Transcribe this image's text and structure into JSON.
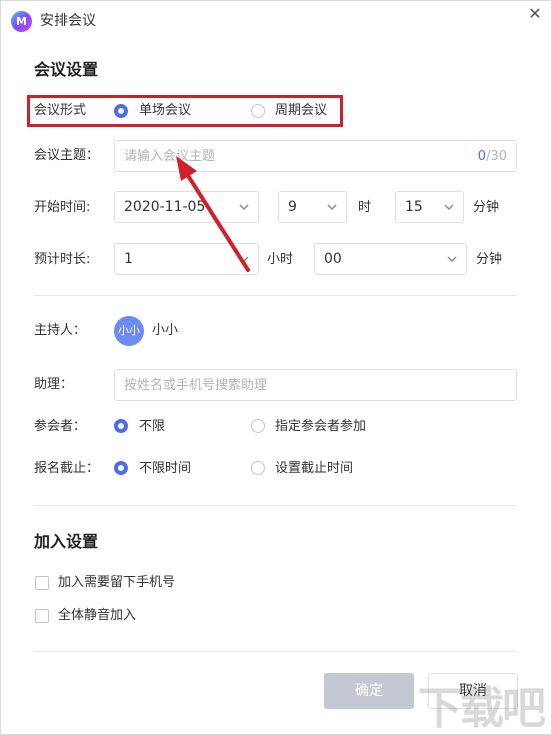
{
  "window": {
    "title": "安排会议"
  },
  "section1": {
    "title": "会议设置"
  },
  "meeting_type": {
    "label": "会议形式",
    "option_single": "单场会议",
    "option_recurring": "周期会议",
    "selected": "单场会议"
  },
  "topic": {
    "label": "会议主题：",
    "placeholder": "请输入会议主题",
    "count": "0",
    "max": "/30"
  },
  "start": {
    "label": "开始时间:",
    "date": "2020-11-05",
    "hour": "9",
    "hour_unit": "时",
    "minute": "15",
    "minute_unit": "分钟"
  },
  "duration": {
    "label": "预计时长:",
    "hours": "1",
    "hours_unit": "小时",
    "minutes": "00",
    "minutes_unit": "分钟"
  },
  "host": {
    "label": "主持人：",
    "avatar_text": "小小",
    "name": "小小"
  },
  "assistant": {
    "label": "助理：",
    "placeholder": "按姓名或手机号搜索助理"
  },
  "attendees": {
    "label": "参会者：",
    "option_unlimited": "不限",
    "option_specified": "指定参会者参加",
    "selected": "不限"
  },
  "deadline": {
    "label": "报名截止：",
    "option_unlimited": "不限时间",
    "option_set": "设置截止时间",
    "selected": "不限时间"
  },
  "section2": {
    "title": "加入设置"
  },
  "join": {
    "require_phone": "加入需要留下手机号",
    "mute_all": "全体静音加入",
    "require_phone_checked": false,
    "mute_all_checked": false
  },
  "buttons": {
    "confirm": "确定",
    "cancel": "取消"
  },
  "watermark": "下载吧",
  "colors": {
    "accent": "#4a6cf7",
    "annotation": "#d0202a",
    "disabled_button": "#c3c8d3"
  },
  "icons": {
    "logo": "app-logo-icon",
    "close": "close-icon",
    "chevron": "chevron-down-icon"
  }
}
